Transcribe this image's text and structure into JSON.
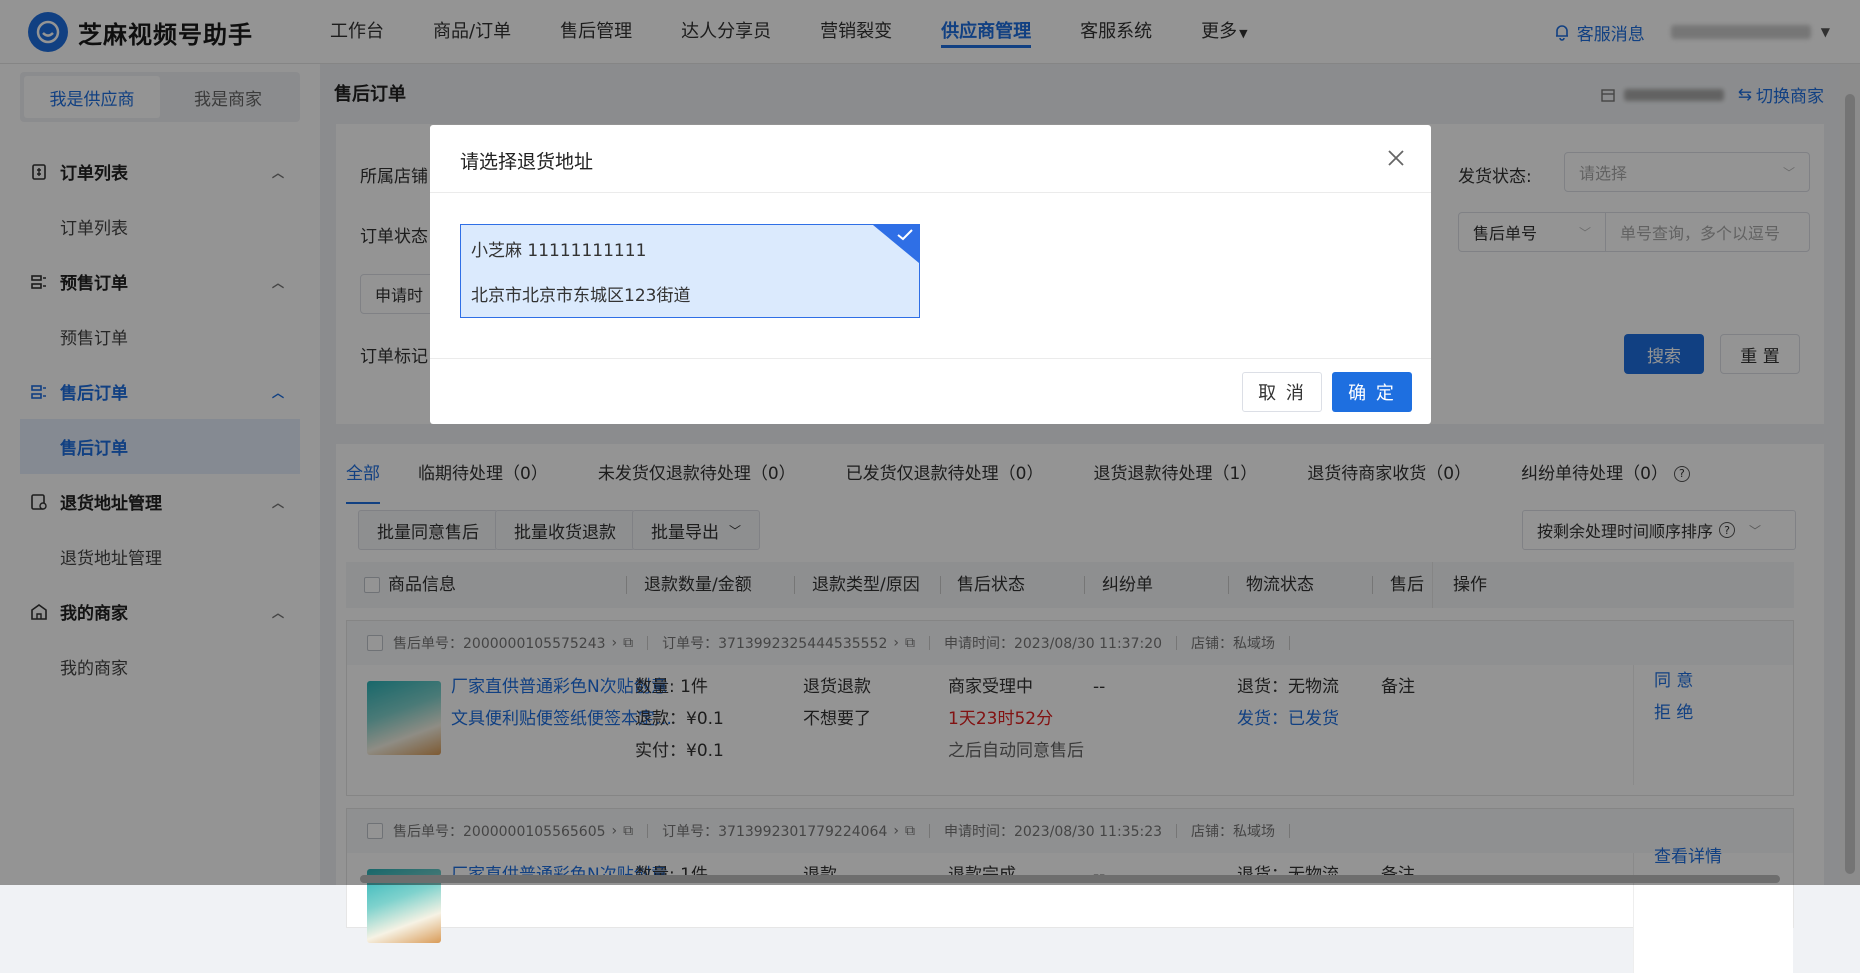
{
  "app": {
    "logo_text": "芝麻视频号助手"
  },
  "nav": {
    "items": [
      "工作台",
      "商品/订单",
      "售后管理",
      "达人分享员",
      "营销裂变",
      "供应商管理",
      "客服系统",
      "更多"
    ],
    "active": "供应商管理",
    "messages_label": "客服消息"
  },
  "sidebar": {
    "roles": [
      "我是供应商",
      "我是商家"
    ],
    "groups": [
      {
        "label": "订单列表",
        "sub": "订单列表"
      },
      {
        "label": "预售订单",
        "sub": "预售订单"
      },
      {
        "label": "售后订单",
        "sub": "售后订单"
      },
      {
        "label": "退货地址管理",
        "sub": "退货地址管理"
      },
      {
        "label": "我的商家",
        "sub": "我的商家"
      }
    ]
  },
  "page": {
    "title": "售后订单",
    "switch_merchant": "切换商家"
  },
  "filters": {
    "shop_label": "所属店铺",
    "order_status_label": "订单状态",
    "apply_time": "申请时",
    "order_mark_label": "订单标记",
    "ship_status_label": "发货状态:",
    "ship_status_placeholder": "请选择",
    "aftersale_no_select": "售后单号",
    "order_no_placeholder": "单号查询，多个以逗号",
    "search_btn": "搜索",
    "reset_btn": "重 置"
  },
  "tabs": [
    "全部",
    "临期待处理（0）",
    "未发货仅退款待处理（0）",
    "已发货仅退款待处理（0）",
    "退货退款待处理（1）",
    "退货待商家收货（0）",
    "纠纷单待处理（0）"
  ],
  "bulk": {
    "agree": "批量同意售后",
    "receive_refund": "批量收货退款",
    "export": "批量导出",
    "sort": "按剩余处理时间顺序排序"
  },
  "table": {
    "columns": [
      "商品信息",
      "退款数量/金额",
      "退款类型/原因",
      "售后状态",
      "纠纷单",
      "物流状态",
      "售后",
      "操作"
    ]
  },
  "orders": [
    {
      "aftersale_no": "售后单号：2000000105575243",
      "order_no": "订单号：3713992325444535552",
      "apply_time": "申请时间：2023/08/30 11:37:20",
      "shop": "店铺：私域场",
      "title_1": "厂家直供普通彩色N次贴创意",
      "title_2": "文具便利贴便签纸便签本定…",
      "qty": "数量: 1件",
      "refund": "退款：¥0.1",
      "paid": "实付：¥0.1",
      "type": "退货退款",
      "reason": "不想要了",
      "status": "商家受理中",
      "countdown": "1天23时52分",
      "status_note": "之后自动同意售后",
      "dispute": "--",
      "logistics_return": "退货：无物流",
      "logistics_ship": "发货：已发货",
      "note": "备注",
      "op_agree": "同 意",
      "op_reject": "拒 绝"
    },
    {
      "aftersale_no": "售后单号：2000000105565605",
      "order_no": "订单号：3713992301779224064",
      "apply_time": "申请时间：2023/08/30 11:35:23",
      "shop": "店铺：私域场",
      "title_1": "厂家直供普通彩色N次贴创意",
      "qty": "数量: 1件",
      "type": "退款",
      "status": "退款完成",
      "dispute": "--",
      "logistics_return": "退货：无物流",
      "note": "备注",
      "op_detail": "查看详情"
    }
  ],
  "modal": {
    "title": "请选择退货地址",
    "address": {
      "name_phone": "小芝麻   11111111111",
      "detail": "北京市北京市东城区123街道"
    },
    "cancel": "取 消",
    "confirm": "确 定"
  },
  "colors": {
    "primary": "#1e6fe0",
    "danger": "#e02020",
    "selected_bg": "#dbeafd"
  }
}
